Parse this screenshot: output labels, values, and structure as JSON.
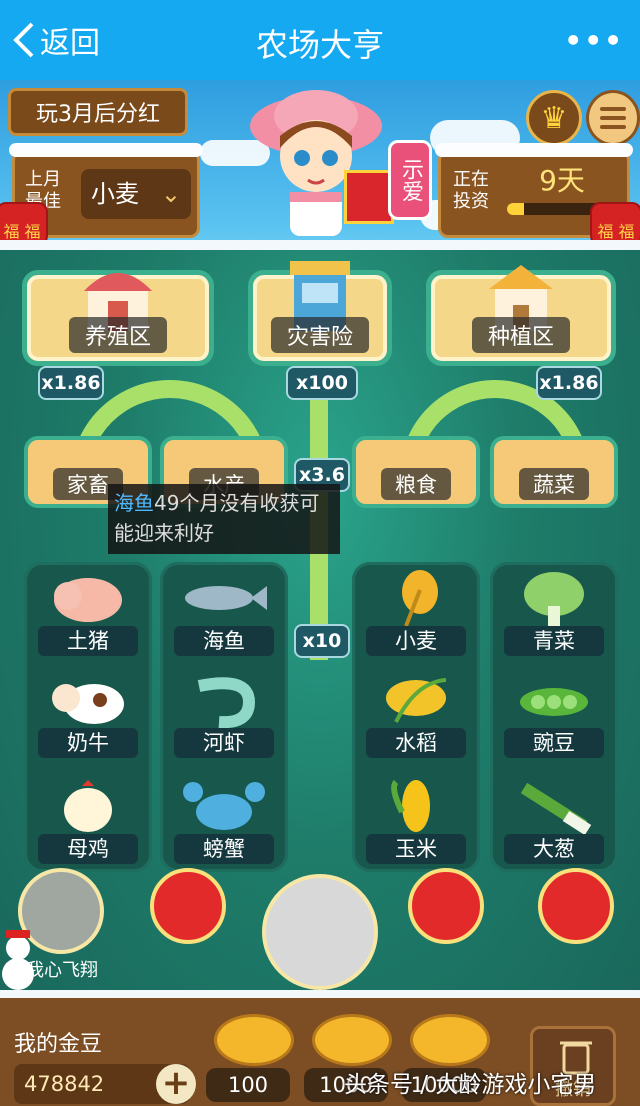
{
  "nav": {
    "back_label": "返回",
    "title": "农场大亨",
    "more": "•••"
  },
  "top": {
    "bonus_banner": "玩3月后分红",
    "last_month_label": "上月\n最佳",
    "best_crop": "小麦",
    "investing_label": "正在\n投资",
    "investing_days": "9天",
    "investing_progress": 0.15,
    "show_love": "示爱",
    "fu_left": "福 福",
    "fu_right": "福 福"
  },
  "zones": [
    {
      "label": "养殖区",
      "mult": "x1.86"
    },
    {
      "label": "灾害险",
      "mult": "x100"
    },
    {
      "label": "种植区",
      "mult": "x1.86"
    }
  ],
  "mid_mult": "x3.6",
  "center_mult": "x10",
  "categories": [
    {
      "label": "家畜"
    },
    {
      "label": "水产"
    },
    {
      "label": "粮食"
    },
    {
      "label": "蔬菜"
    }
  ],
  "tooltip": {
    "highlight": "海鱼",
    "text": "49个月没有收获可能迎来利好"
  },
  "columns": [
    {
      "items": [
        "土猪",
        "奶牛",
        "母鸡"
      ]
    },
    {
      "items": [
        "海鱼",
        "河虾",
        "螃蟹"
      ]
    },
    {
      "items": [
        "小麦",
        "水稻",
        "玉米"
      ]
    },
    {
      "items": [
        "青菜",
        "豌豆",
        "大葱"
      ]
    }
  ],
  "friend_name": "我心飞翔",
  "footer": {
    "gold_label": "我的金豆",
    "gold_value": "478842",
    "plus": "+",
    "bets": [
      "100",
      "1000",
      "10000"
    ],
    "trash_label": "撤销"
  },
  "watermark": "头条号 / 大龄游戏小宅男",
  "colors": {
    "nav": "#14a9f0",
    "board": "#1e7c69",
    "wood": "#8a5420",
    "pipe": "#a8e06a"
  }
}
